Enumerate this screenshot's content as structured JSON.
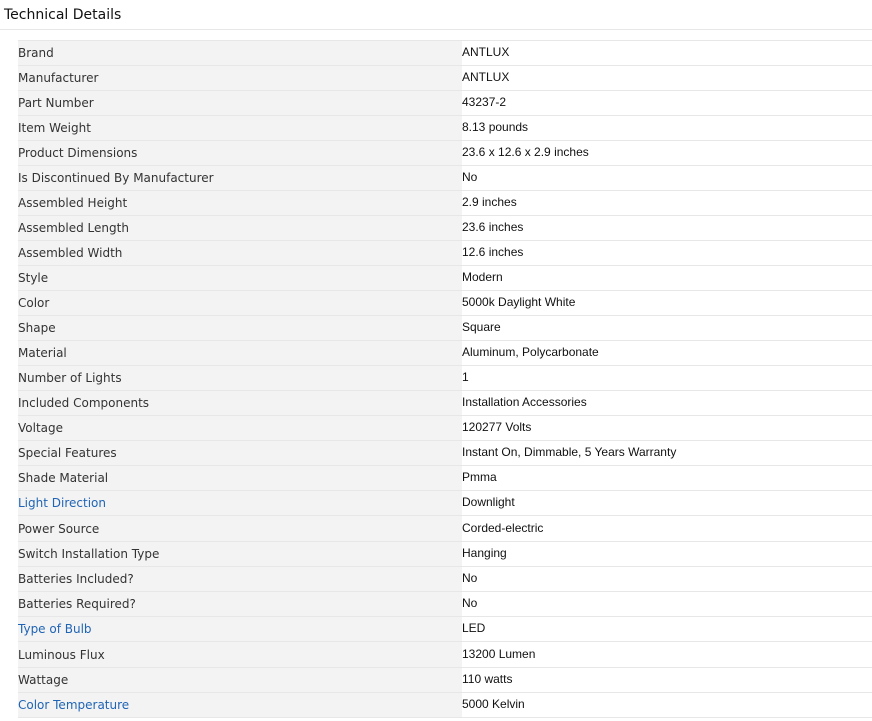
{
  "section_title": "Technical Details",
  "rows": [
    {
      "label": "Brand",
      "value": "ANTLUX",
      "link": false
    },
    {
      "label": "Manufacturer",
      "value": "ANTLUX",
      "link": false
    },
    {
      "label": "Part Number",
      "value": "43237-2",
      "link": false
    },
    {
      "label": "Item Weight",
      "value": "8.13 pounds",
      "link": false
    },
    {
      "label": "Product Dimensions",
      "value": "23.6 x 12.6 x 2.9 inches",
      "link": false
    },
    {
      "label": "Is Discontinued By Manufacturer",
      "value": "No",
      "link": false
    },
    {
      "label": "Assembled Height",
      "value": "2.9 inches",
      "link": false
    },
    {
      "label": "Assembled Length",
      "value": "23.6 inches",
      "link": false
    },
    {
      "label": "Assembled Width",
      "value": "12.6 inches",
      "link": false
    },
    {
      "label": "Style",
      "value": "Modern",
      "link": false
    },
    {
      "label": "Color",
      "value": "5000k Daylight White",
      "link": false
    },
    {
      "label": "Shape",
      "value": "Square",
      "link": false
    },
    {
      "label": "Material",
      "value": "Aluminum, Polycarbonate",
      "link": false
    },
    {
      "label": "Number of Lights",
      "value": "1",
      "link": false
    },
    {
      "label": "Included Components",
      "value": "Installation Accessories",
      "link": false
    },
    {
      "label": "Voltage",
      "value": "120277 Volts",
      "link": false
    },
    {
      "label": "Special Features",
      "value": "Instant On, Dimmable, 5 Years Warranty",
      "link": false
    },
    {
      "label": "Shade Material",
      "value": "Pmma",
      "link": false
    },
    {
      "label": "Light Direction",
      "value": "Downlight",
      "link": true
    },
    {
      "label": "Power Source",
      "value": "Corded-electric",
      "link": false
    },
    {
      "label": "Switch Installation Type",
      "value": "Hanging",
      "link": false
    },
    {
      "label": "Batteries Included?",
      "value": "No",
      "link": false
    },
    {
      "label": "Batteries Required?",
      "value": "No",
      "link": false
    },
    {
      "label": "Type of Bulb",
      "value": "LED",
      "link": true
    },
    {
      "label": "Luminous Flux",
      "value": "13200 Lumen",
      "link": false
    },
    {
      "label": "Wattage",
      "value": "110 watts",
      "link": false
    },
    {
      "label": "Color Temperature",
      "value": "5000 Kelvin",
      "link": true
    }
  ],
  "colors": {
    "label_bg": "#f3f3f3",
    "link": "#1f64b5",
    "border": "#e7e7e7"
  }
}
